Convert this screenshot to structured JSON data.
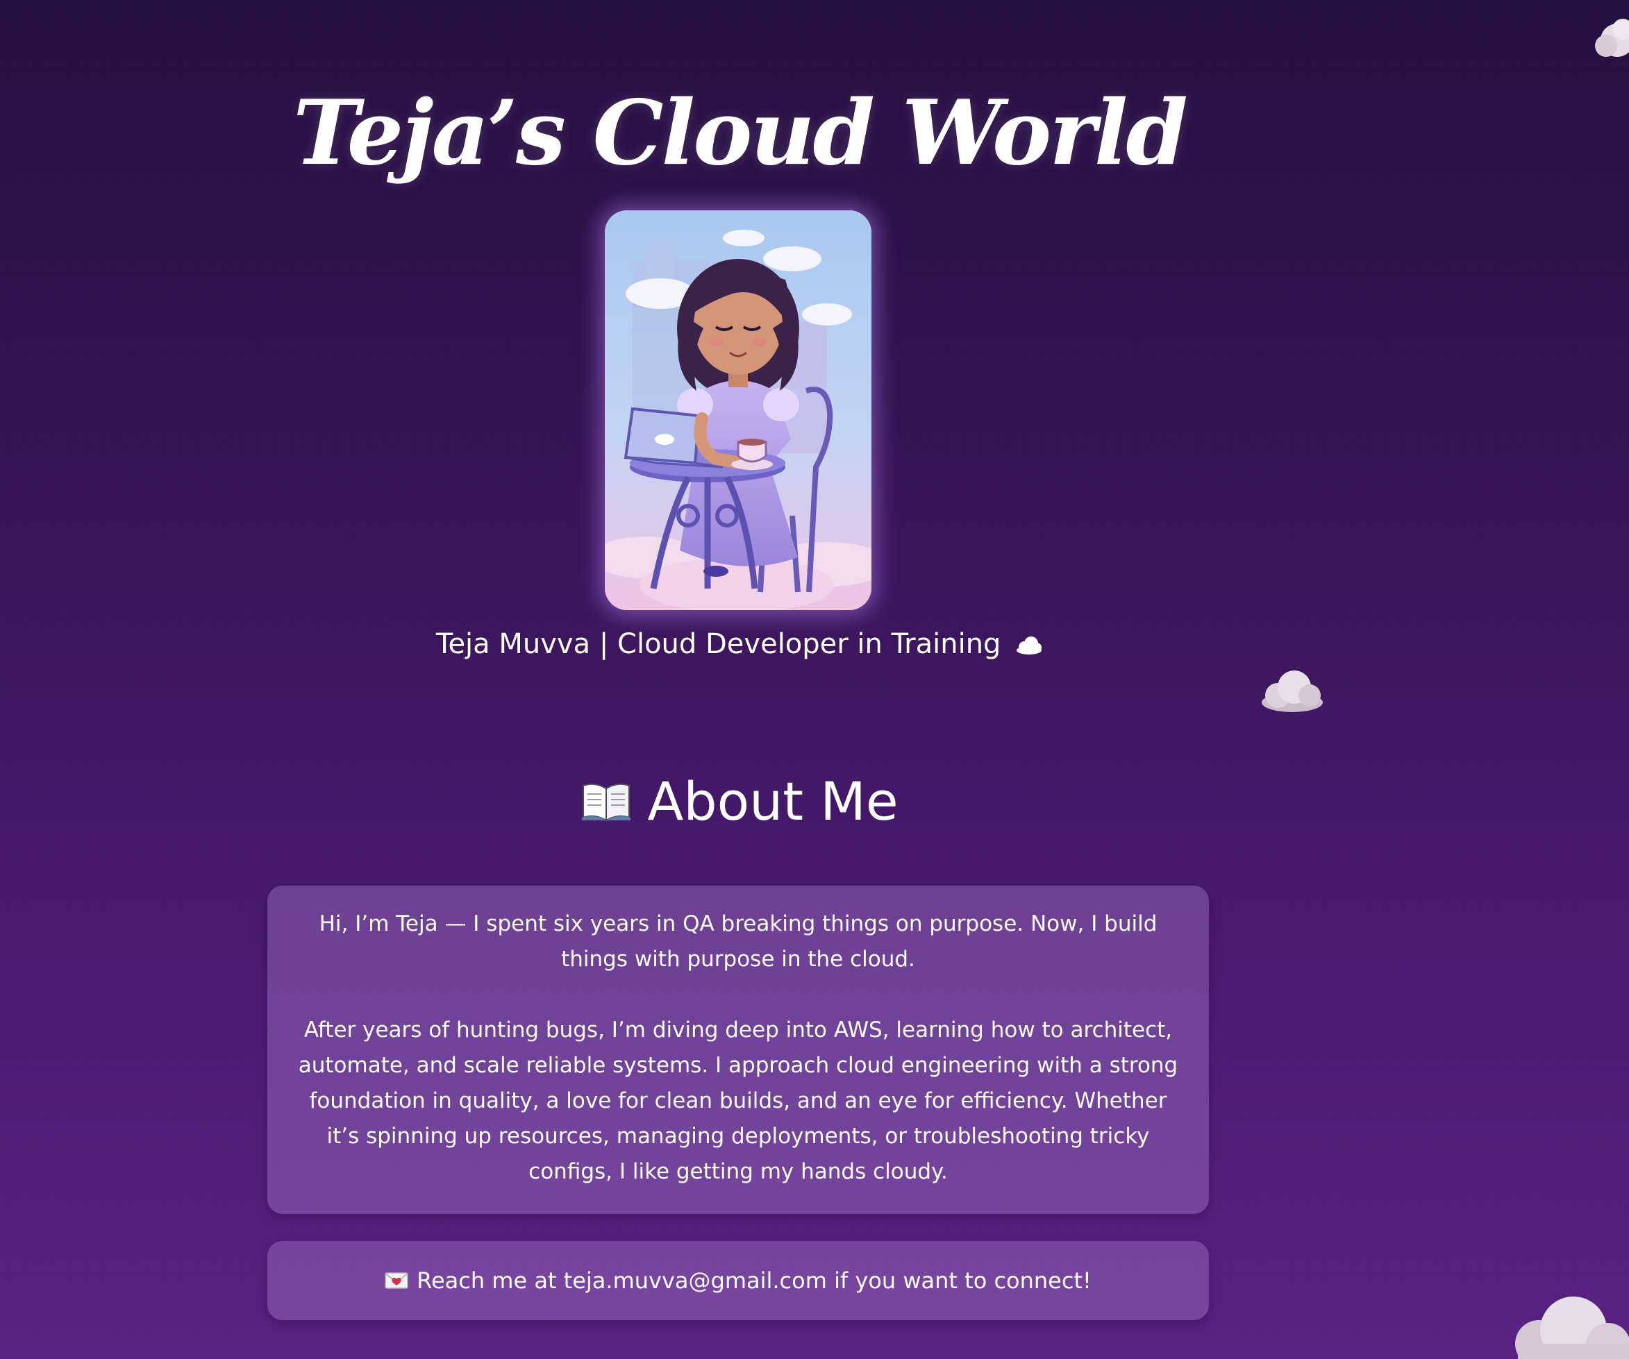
{
  "header": {
    "title": "Teja’s Cloud World"
  },
  "profile": {
    "tagline": "Teja Muvva | Cloud Developer in Training",
    "tagline_icon": "cloud-icon"
  },
  "about": {
    "heading": "About Me",
    "heading_icon": "open-book-icon",
    "paragraphs": [
      "Hi, I’m Teja — I spent six years in QA breaking things on purpose. Now, I build things with purpose in the cloud.",
      "After years of hunting bugs, I’m diving deep into AWS, learning how to architect, automate, and scale reliable systems. I approach cloud engineering with a strong foundation in quality, a love for clean builds, and an eye for efficiency. Whether it’s spinning up resources, managing deployments, or troubleshooting tricky configs, I like getting my hands cloudy."
    ]
  },
  "contact": {
    "icon": "love-letter-icon",
    "text": "Reach me at teja.muvva@gmail.com if you want to connect!"
  },
  "colors": {
    "background_top": "#260f42",
    "background_bottom": "#5a2282",
    "card_fill": "#7a55a0",
    "text": "#ffffff",
    "avatar_glow": "#be8cff"
  }
}
